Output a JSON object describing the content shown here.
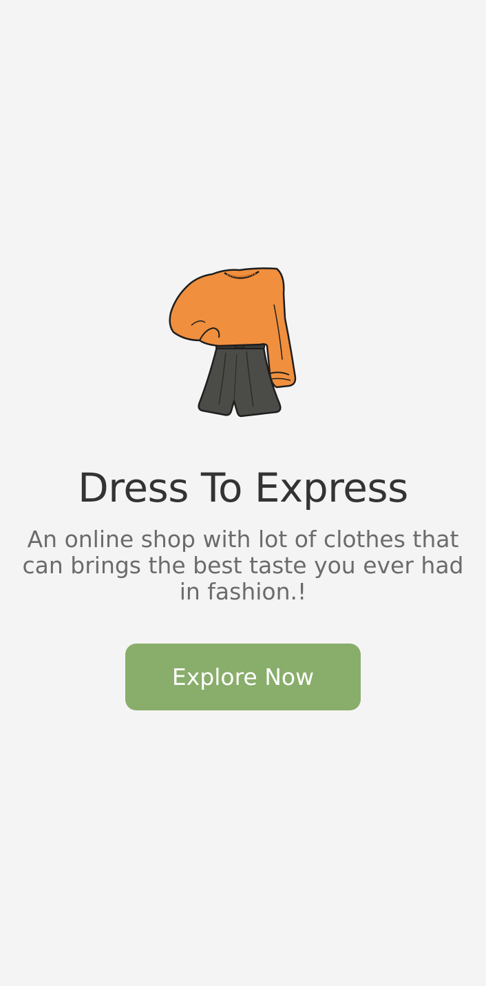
{
  "onboarding": {
    "illustration": "sweater-and-skirt-outfit-image",
    "title": "Dress To Express",
    "description": "An online shop with lot of clothes that can brings the best taste you ever had in fashion.!",
    "cta_label": "Explore Now"
  },
  "colors": {
    "background": "#f4f4f4",
    "title": "#333333",
    "description": "#6b6b6b",
    "cta_background": "#89ad6b",
    "cta_text": "#ffffff",
    "sweater": "#f08f3e",
    "skirt": "#4b4b48"
  }
}
